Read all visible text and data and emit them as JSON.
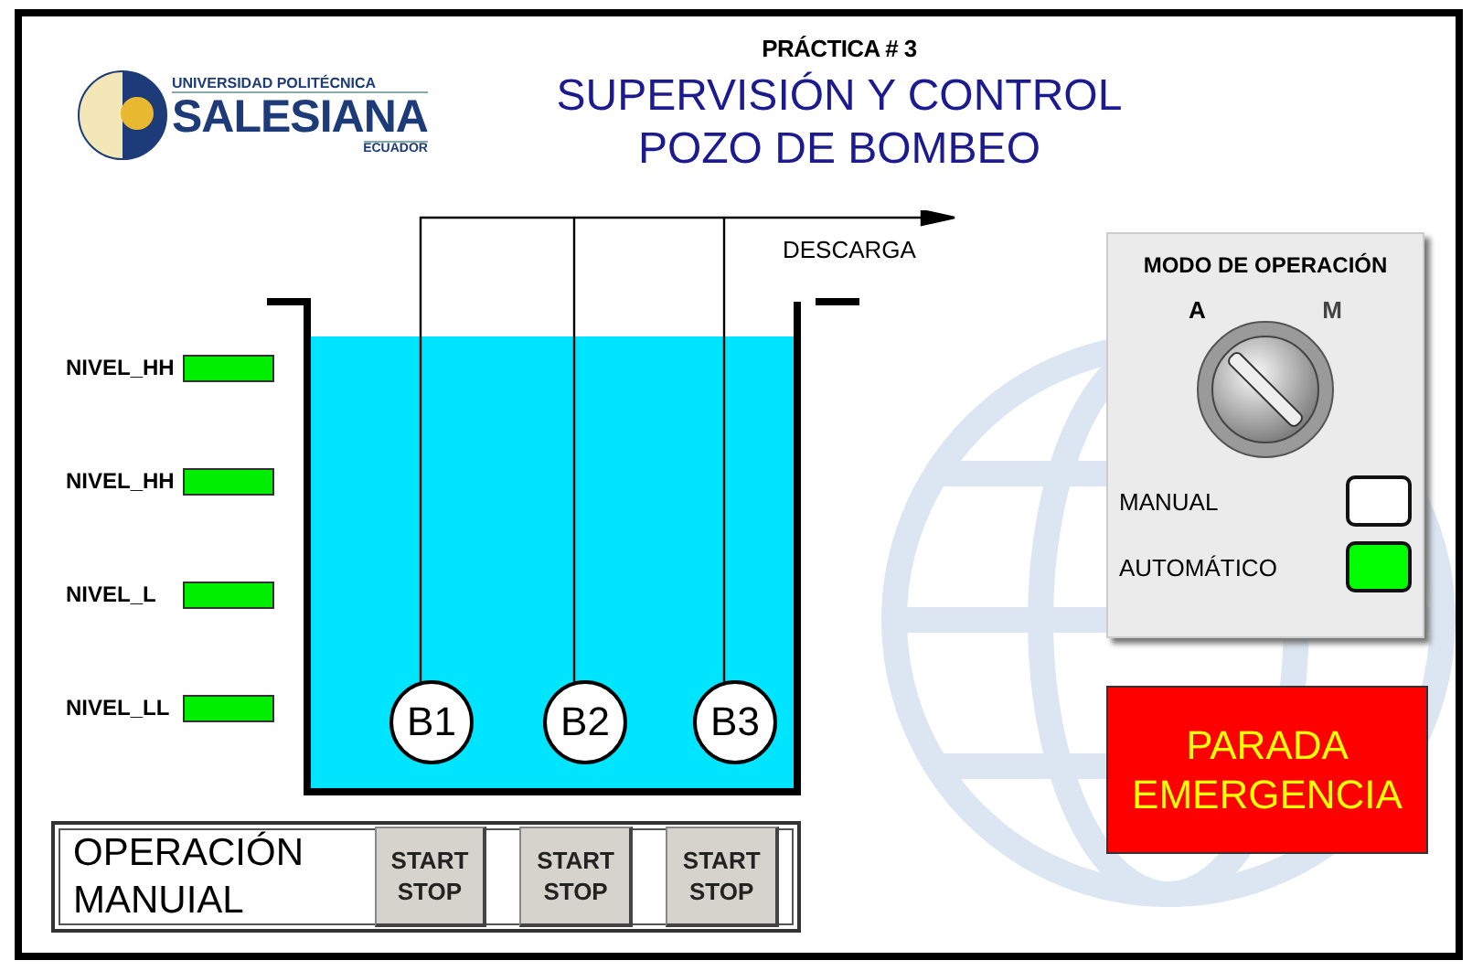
{
  "header": {
    "practice": "PRÁCTICA # 3",
    "title_lines": [
      "SUPERVISIÓN Y CONTROL",
      "POZO DE BOMBEO"
    ]
  },
  "logo": {
    "top": "UNIVERSIDAD POLITÉCNICA",
    "name": "SALESIANA",
    "country": "ECUADOR"
  },
  "levels": [
    {
      "label": "NIVEL_HH",
      "on": true
    },
    {
      "label": "NIVEL_HH",
      "on": true
    },
    {
      "label": "NIVEL_L",
      "on": true
    },
    {
      "label": "NIVEL_LL",
      "on": true
    }
  ],
  "tank": {
    "level": 0.93,
    "discharge": "DESCARGA",
    "pumps": [
      "B1",
      "B2",
      "B3"
    ]
  },
  "manual_operation": {
    "title_lines": [
      "OPERACIÓN",
      "MANUIAL"
    ],
    "buttons": [
      {
        "lines": [
          "START",
          "STOP"
        ]
      },
      {
        "lines": [
          "START",
          "STOP"
        ]
      },
      {
        "lines": [
          "START",
          "STOP"
        ]
      }
    ]
  },
  "mode_panel": {
    "title": "MODO DE OPERACIÓN",
    "positions": [
      {
        "label": "A",
        "selected": true
      },
      {
        "label": "M",
        "selected": false
      }
    ],
    "lamps": [
      {
        "label": "MANUAL",
        "on": false
      },
      {
        "label": "AUTOMÁTICO",
        "on": true
      }
    ]
  },
  "emergency": {
    "lines": [
      "PARADA",
      "EMERGENCIA"
    ]
  }
}
